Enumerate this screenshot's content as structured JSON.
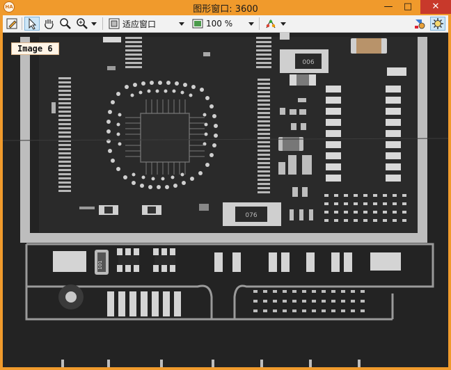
{
  "window": {
    "title": "图形窗口: 3600",
    "app_icon_text": "HA",
    "minimize": "—",
    "maximize": "□",
    "close": "✕"
  },
  "toolbar": {
    "fit_label": "适应窗口",
    "zoom_value": "100 %"
  },
  "image_label": "Image 6",
  "board_markings": {
    "chip1": "006",
    "chip2": "076",
    "resistor": "101"
  },
  "colors": {
    "frame": "#f09a2c",
    "board_bg": "#222222",
    "trace": "#d4d4d4"
  }
}
